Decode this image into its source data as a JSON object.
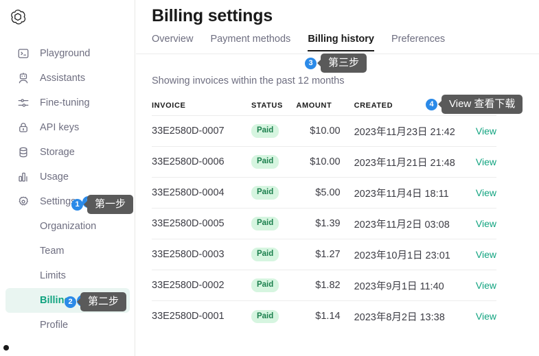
{
  "sidebar": {
    "logo_icon": "openai-logo-icon",
    "items": [
      {
        "label": "Playground",
        "icon": "terminal-icon",
        "active": false
      },
      {
        "label": "Assistants",
        "icon": "robot-icon",
        "active": false
      },
      {
        "label": "Fine-tuning",
        "icon": "sliders-icon",
        "active": false
      },
      {
        "label": "API keys",
        "icon": "lock-icon",
        "active": false
      },
      {
        "label": "Storage",
        "icon": "database-icon",
        "active": false
      },
      {
        "label": "Usage",
        "icon": "bar-chart-icon",
        "active": false
      },
      {
        "label": "Settings",
        "icon": "gear-icon",
        "active": false,
        "step": "1"
      }
    ],
    "sub_items": [
      {
        "label": "Organization",
        "active": false
      },
      {
        "label": "Team",
        "active": false
      },
      {
        "label": "Limits",
        "active": false
      },
      {
        "label": "Billing",
        "active": true,
        "step": "2"
      },
      {
        "label": "Profile",
        "active": false
      }
    ]
  },
  "callouts": [
    {
      "number": "1",
      "text": "第一步"
    },
    {
      "number": "2",
      "text": "第二步"
    },
    {
      "number": "3",
      "text": "第三步"
    },
    {
      "number": "4",
      "text": "View 查看下载"
    }
  ],
  "main": {
    "title": "Billing settings",
    "tabs": [
      {
        "label": "Overview",
        "active": false
      },
      {
        "label": "Payment methods",
        "active": false
      },
      {
        "label": "Billing history",
        "active": true
      },
      {
        "label": "Preferences",
        "active": false
      }
    ],
    "showing_note": "Showing invoices within the past 12 months",
    "table": {
      "columns": [
        "INVOICE",
        "STATUS",
        "AMOUNT",
        "CREATED",
        ""
      ],
      "action_label": "View",
      "rows": [
        {
          "invoice": "33E2580D-0007",
          "status": "Paid",
          "amount": "$10.00",
          "created": "2023年11月23日 21:42",
          "action": "View"
        },
        {
          "invoice": "33E2580D-0006",
          "status": "Paid",
          "amount": "$10.00",
          "created": "2023年11月21日 21:48",
          "action": "View"
        },
        {
          "invoice": "33E2580D-0004",
          "status": "Paid",
          "amount": "$5.00",
          "created": "2023年11月4日 18:11",
          "action": "View"
        },
        {
          "invoice": "33E2580D-0005",
          "status": "Paid",
          "amount": "$1.39",
          "created": "2023年11月2日 03:08",
          "action": "View"
        },
        {
          "invoice": "33E2580D-0003",
          "status": "Paid",
          "amount": "$1.27",
          "created": "2023年10月1日 23:01",
          "action": "View"
        },
        {
          "invoice": "33E2580D-0002",
          "status": "Paid",
          "amount": "$1.82",
          "created": "2023年9月1日 11:40",
          "action": "View"
        },
        {
          "invoice": "33E2580D-0001",
          "status": "Paid",
          "amount": "$1.14",
          "created": "2023年8月2日 13:38",
          "action": "View"
        }
      ]
    }
  },
  "colors": {
    "accent_green": "#10a37f",
    "badge_bg": "#d6f5e0",
    "badge_text": "#1b7f4d",
    "callout_bg": "#5a5a5a",
    "step_blue": "#2b8ae8",
    "active_nav_bg": "#e9f5f1",
    "text_muted": "#6e6e80",
    "text_dark": "#1a1a1a"
  }
}
